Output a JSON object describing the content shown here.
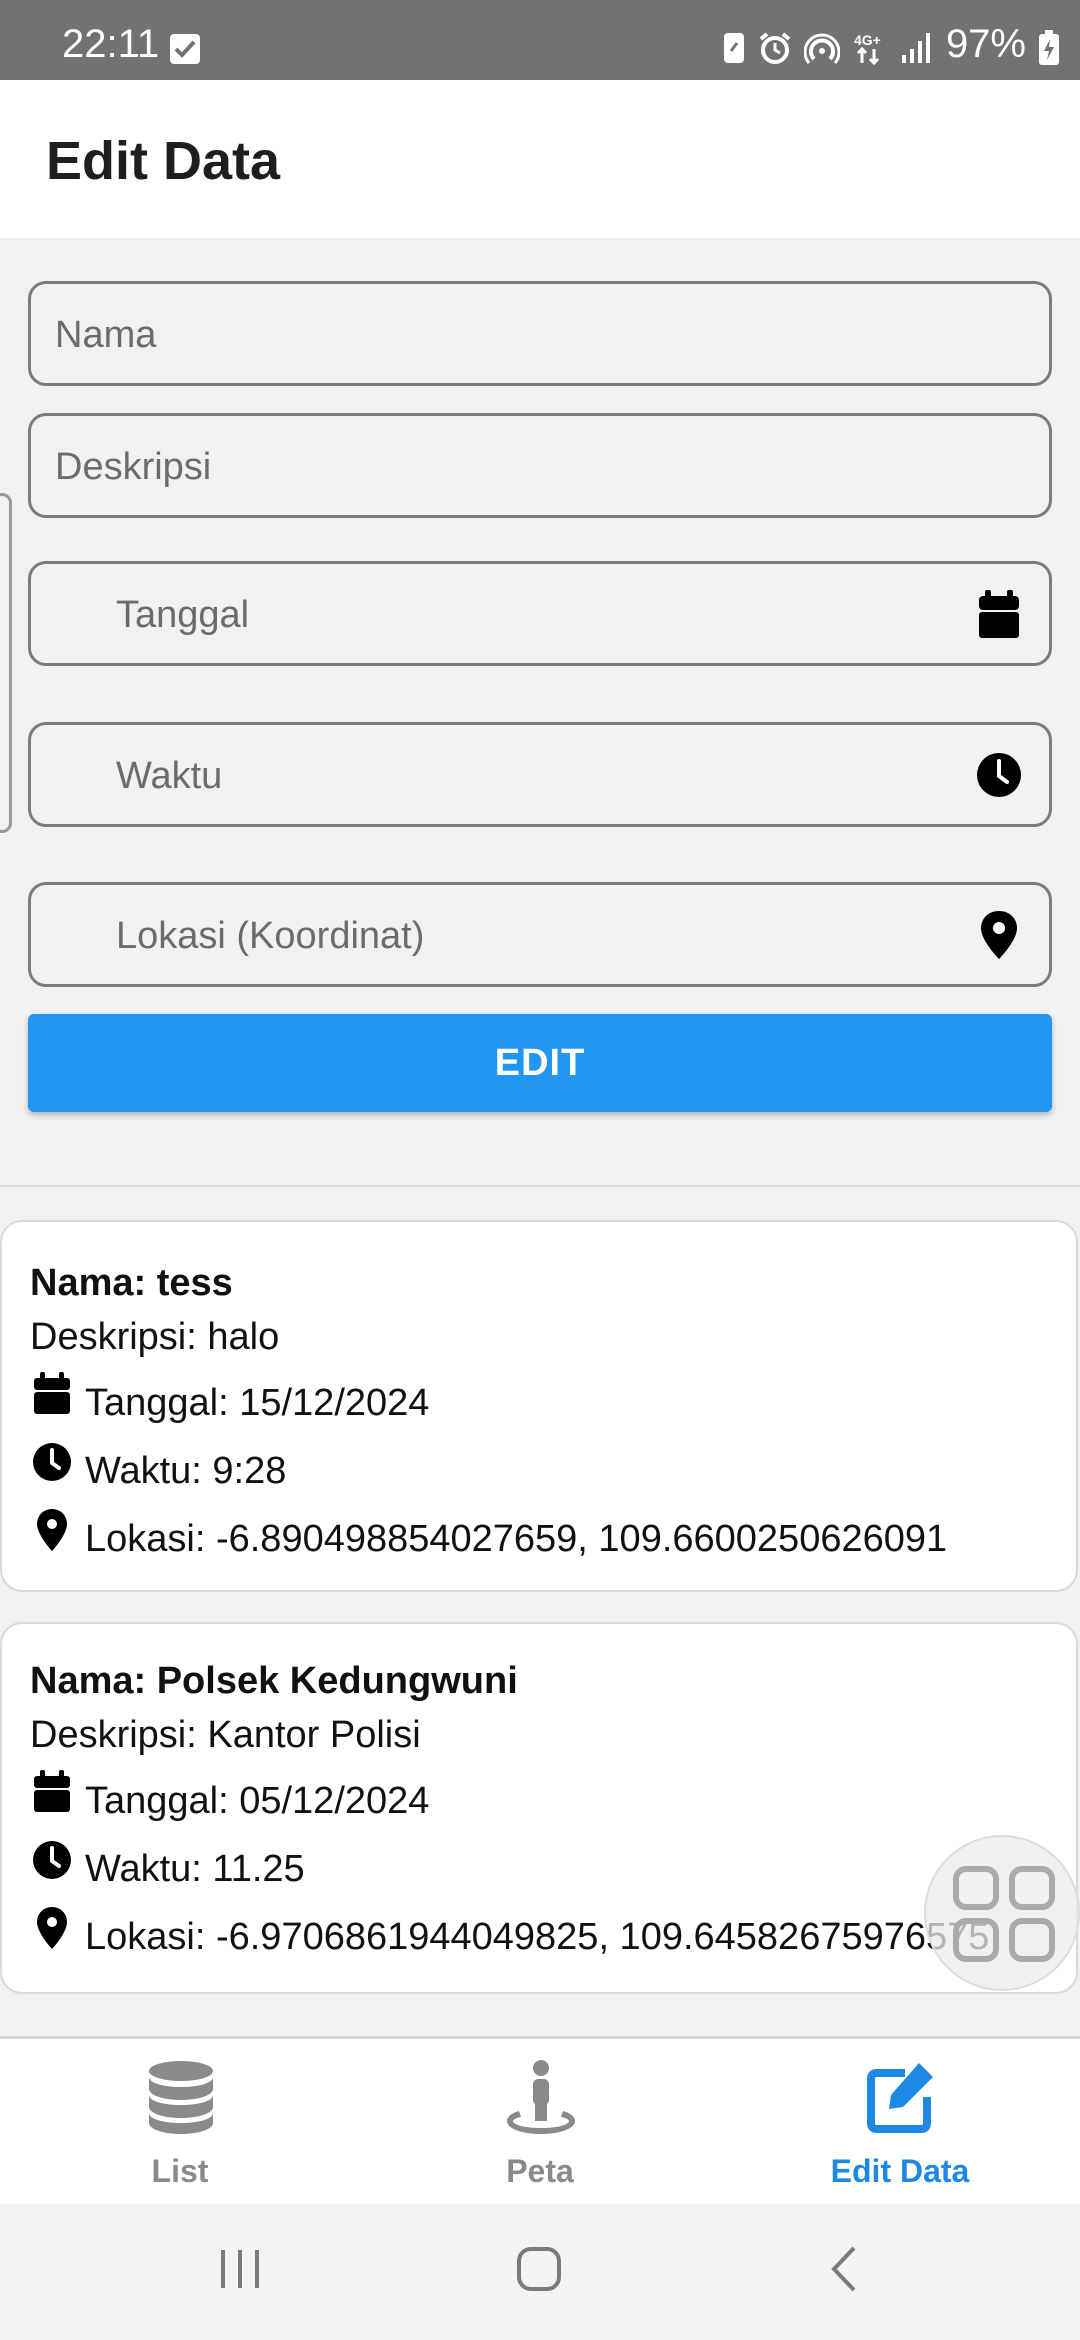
{
  "status_bar": {
    "time": "22:11",
    "battery": "97%",
    "network": "4G+"
  },
  "app_bar": {
    "title": "Edit Data"
  },
  "form": {
    "nama_placeholder": "Nama",
    "deskripsi_placeholder": "Deskripsi",
    "tanggal_placeholder": "Tanggal",
    "waktu_placeholder": "Waktu",
    "lokasi_placeholder": "Lokasi (Koordinat)",
    "submit_label": "EDIT"
  },
  "items": [
    {
      "nama": "Nama: tess",
      "deskripsi": "Deskripsi: halo",
      "tanggal": "Tanggal: 15/12/2024",
      "waktu": "Waktu: 9:28",
      "lokasi": "Lokasi: -6.890498854027659, 109.6600250626091"
    },
    {
      "nama": "Nama: Polsek Kedungwuni",
      "deskripsi": "Deskripsi: Kantor Polisi",
      "tanggal": "Tanggal: 05/12/2024",
      "waktu": "Waktu: 11.25",
      "lokasi": "Lokasi: -6.9706861944049825, 109.64582675976575"
    }
  ],
  "bottom_nav": {
    "items": [
      {
        "label": "List",
        "icon": "database-icon"
      },
      {
        "label": "Peta",
        "icon": "person-location-icon"
      },
      {
        "label": "Edit Data",
        "icon": "edit-icon"
      }
    ],
    "active_index": 2
  },
  "colors": {
    "accent": "#2196f3",
    "active_nav": "#1e88e5",
    "status_bar": "#727272"
  }
}
